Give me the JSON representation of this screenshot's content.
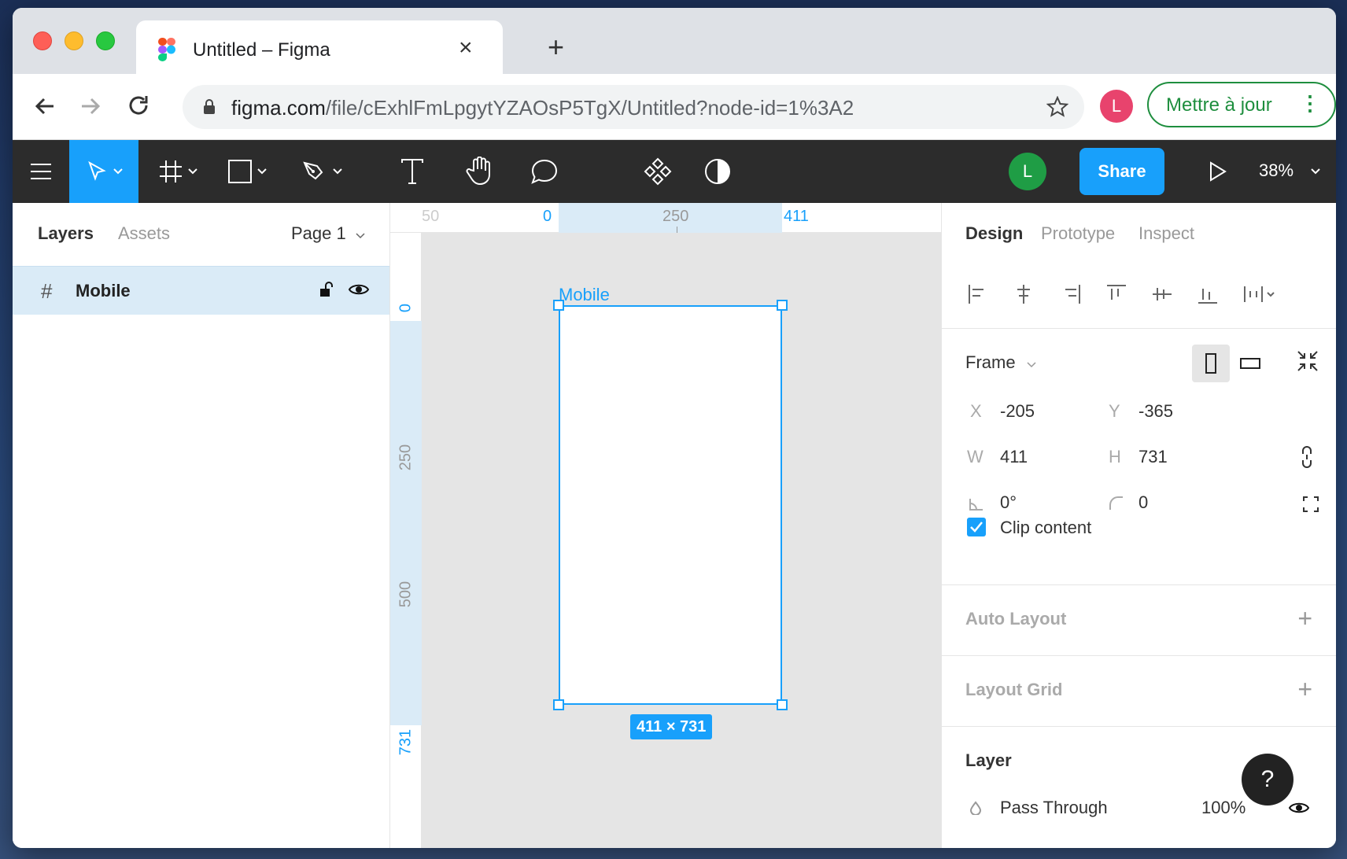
{
  "browser": {
    "tab_title": "Untitled – Figma",
    "close_glyph": "×",
    "newtab_glyph": "+",
    "url_host": "figma.com",
    "url_path": "/file/cExhlFmLpgytYZAOsP5TgX/Untitled?node-id=1%3A2",
    "profile_initial": "L",
    "update_label": "Mettre à jour",
    "menu_glyph": "⋮"
  },
  "figma_toolbar": {
    "tools": [
      "menu",
      "move",
      "frame",
      "rectangle",
      "pen",
      "text",
      "hand",
      "comment",
      "components",
      "theme"
    ],
    "active_tool": "move",
    "user_initial": "L",
    "share_label": "Share",
    "zoom": "38%"
  },
  "left_panel": {
    "tabs": [
      "Layers",
      "Assets"
    ],
    "page": "Page 1",
    "layers": [
      {
        "name": "Mobile",
        "icon": "frame-icon",
        "glyph": "#"
      }
    ]
  },
  "canvas": {
    "ruler_top": [
      "50",
      "0",
      "250",
      "411"
    ],
    "ruler_left": [
      "0",
      "250",
      "500",
      "731"
    ],
    "frame_name": "Mobile",
    "size_badge": "411 × 731"
  },
  "right_panel": {
    "tabs": [
      "Design",
      "Prototype",
      "Inspect"
    ],
    "frame_label": "Frame",
    "x_label": "X",
    "x": "-205",
    "y_label": "Y",
    "y": "-365",
    "w_label": "W",
    "w": "411",
    "h_label": "H",
    "h": "731",
    "rotation": "0°",
    "radius": "0",
    "clip_content": "Clip content",
    "auto_layout": "Auto Layout",
    "layout_grid": "Layout Grid",
    "layer": "Layer",
    "blend_mode": "Pass Through",
    "opacity": "100%",
    "plus_glyph": "+"
  },
  "help_label": "?",
  "colors": {
    "accent": "#18a0fb",
    "toolbar_bg": "#2c2c2c",
    "selection_bg": "#daebf7",
    "update_green": "#1e8e3e"
  }
}
